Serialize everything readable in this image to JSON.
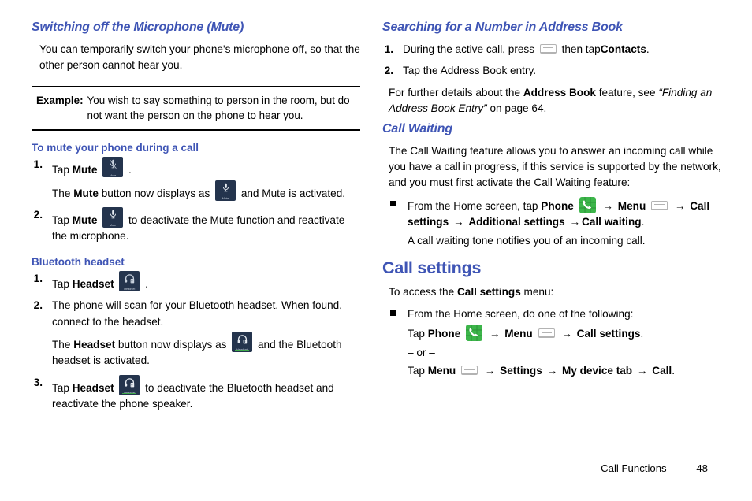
{
  "left_column": {
    "heading": "Switching off the Microphone (Mute)",
    "intro": "You can temporarily switch your phone's microphone off, so that the other person cannot hear you.",
    "example": {
      "label": "Example:",
      "text": "You wish to say something to person in the room, but do not want the person on the phone to hear you."
    },
    "mute_section": {
      "subheading": "To mute your phone during a call",
      "step1": {
        "num": "1.",
        "lead": "Tap",
        "bold": "Mute",
        "icon": "mute-button-icon",
        "after": ".",
        "cont_a": "The",
        "cont_bold": "Mute",
        "cont_b": "button now displays as",
        "cont_icon": "mute-button-active-icon",
        "cont_c": "and Mute is activated."
      },
      "step2": {
        "num": "2.",
        "lead": "Tap",
        "bold": "Mute",
        "icon": "mute-button-active-icon",
        "after": "to deactivate the Mute function and reactivate the microphone."
      }
    },
    "bluetooth_section": {
      "subheading": "Bluetooth headset",
      "step1": {
        "num": "1.",
        "lead": "Tap",
        "bold": "Headset",
        "icon": "headset-button-icon",
        "after": "."
      },
      "step2": {
        "num": "2.",
        "text": "The phone will scan for your Bluetooth headset. When found, connect to the headset.",
        "cont_a": "The",
        "cont_bold": "Headset",
        "cont_b": "button now displays as",
        "cont_icon": "headset-button-active-icon",
        "cont_c": "and the Bluetooth headset is activated."
      },
      "step3": {
        "num": "3.",
        "lead": "Tap",
        "bold": "Headset",
        "icon": "headset-button-active-icon",
        "after": "to deactivate the Bluetooth headset and reactivate the phone speaker."
      }
    }
  },
  "right_column": {
    "search_section": {
      "heading": "Searching for a Number in Address Book",
      "step1": {
        "num": "1.",
        "lead": "During the active call, press",
        "icon": "menu-key-icon",
        "mid": "then tap",
        "bold": "Contacts",
        "after": "."
      },
      "step2": {
        "num": "2.",
        "text": "Tap the Address Book entry."
      },
      "note": {
        "a": "For further details about the",
        "bold": "Address Book",
        "b": "feature, see",
        "italic": "“Finding an Address Book Entry”",
        "c": "on page 64."
      }
    },
    "call_waiting_section": {
      "heading": "Call Waiting",
      "body": "The Call Waiting feature allows you to answer an incoming call while you have a call in progress, if this service is supported by the network, and you must first activate the Call Waiting feature:",
      "bullet": {
        "lead": "From the Home screen, tap",
        "phone_bold": "Phone",
        "phone_icon": "phone-app-icon",
        "menu_bold": "Menu",
        "menu_icon": "menu-key-icon",
        "path_bold_1": "Call settings",
        "path_bold_2": "Additional settings",
        "path_bold_3": "Call waiting",
        "period": ".",
        "cont": "A call waiting tone notifies you of an incoming call."
      }
    },
    "call_settings_section": {
      "heading": "Call settings",
      "intro_a": "To access the",
      "intro_bold": "Call settings",
      "intro_b": "menu:",
      "bullet": {
        "lead": "From the Home screen, do one of the following:",
        "opt1_tap": "Tap",
        "opt1_phone_bold": "Phone",
        "opt1_phone_icon": "phone-app-icon",
        "opt1_menu_bold": "Menu",
        "opt1_menu_icon": "menu-key-icon",
        "opt1_target": "Call settings",
        "opt1_period": ".",
        "or_text": "– or –",
        "opt2_tap": "Tap",
        "opt2_menu_bold": "Menu",
        "opt2_menu_icon": "menu-key-icon",
        "opt2_settings": "Settings",
        "opt2_mydevice": "My device tab",
        "opt2_call": "Call",
        "opt2_period": "."
      }
    }
  },
  "footer": {
    "chapter": "Call Functions",
    "page_number": "48"
  },
  "arrow_glyph": "→",
  "colors": {
    "heading_blue": "#3f55b5",
    "icon_navy": "#24344d",
    "phone_green": "#3cb54a",
    "active_green": "#3faa4a",
    "menu_key_gray": "#b3b3b3"
  }
}
